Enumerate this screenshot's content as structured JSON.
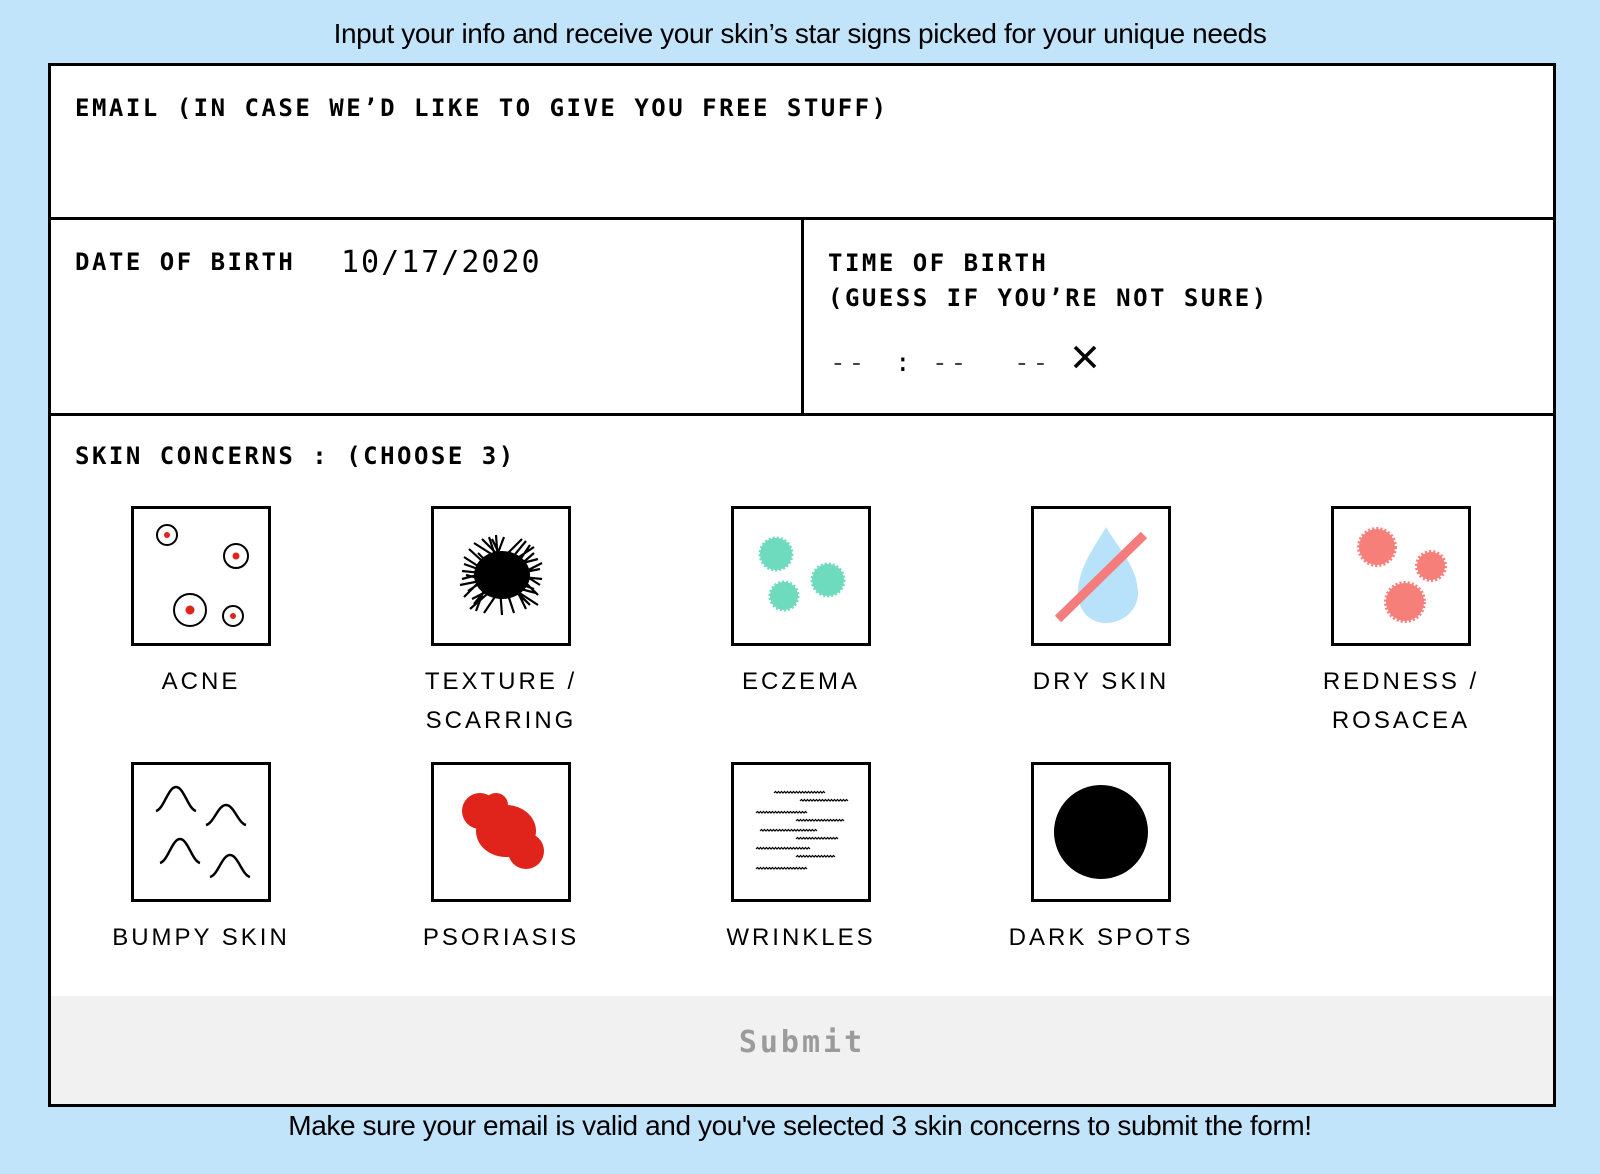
{
  "header_text": "Input your info and receive your skin’s star signs picked for your unique needs",
  "footer_text": "Make sure your email is valid and you've selected 3 skin concerns to submit the form!",
  "email": {
    "label": "EMAIL (IN CASE WE’D LIKE TO GIVE YOU FREE STUFF)",
    "value": ""
  },
  "dob": {
    "label": "DATE OF BIRTH",
    "value": "10/17/2020"
  },
  "tob": {
    "label_line1": "TIME OF BIRTH",
    "label_line2": "(GUESS IF YOU’RE NOT SURE)",
    "hour": "--",
    "separator": ":",
    "minute": "--",
    "ampm": "--",
    "clear_icon": "close-icon"
  },
  "concerns": {
    "label": "SKIN CONCERNS : (CHOOSE 3)",
    "items": [
      {
        "label": "ACNE",
        "icon": "acne-icon"
      },
      {
        "label": "TEXTURE /\nSCARRING",
        "icon": "texture-icon"
      },
      {
        "label": "ECZEMA",
        "icon": "eczema-icon"
      },
      {
        "label": "DRY SKIN",
        "icon": "dry-skin-icon"
      },
      {
        "label": "REDNESS /\nROSACEA",
        "icon": "redness-icon"
      },
      {
        "label": "BUMPY SKIN",
        "icon": "bumpy-skin-icon"
      },
      {
        "label": "PSORIASIS",
        "icon": "psoriasis-icon"
      },
      {
        "label": "WRINKLES",
        "icon": "wrinkles-icon"
      },
      {
        "label": "DARK SPOTS",
        "icon": "dark-spots-icon"
      }
    ]
  },
  "submit_label": "Submit",
  "colors": {
    "background": "#c2e4fb",
    "acne_red": "#e0231b",
    "eczema_teal": "#6fdbbe",
    "dry_blue": "#b7e2fa",
    "dry_slash": "#f47c7c",
    "redness_salmon": "#f77f7a",
    "psoriasis_red": "#e0231b",
    "submit_bg": "#f1f1f1",
    "submit_text": "#9b9b9b"
  }
}
